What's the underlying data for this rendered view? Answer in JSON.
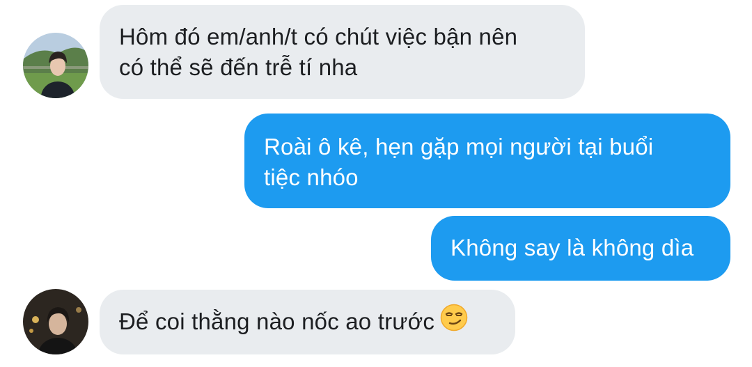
{
  "conversation": {
    "messages": [
      {
        "sender": "incoming",
        "avatar_icon": "user-avatar-outdoor-photo",
        "lines": [
          "Hôm đó em/anh/t có chút việc bận nên",
          "có thể sẽ đến trễ tí nha"
        ]
      },
      {
        "sender": "outgoing",
        "lines": [
          "Roài ô kê, hẹn gặp mọi người tại buổi",
          "tiệc nhóo"
        ]
      },
      {
        "sender": "outgoing",
        "lines": [
          "Không say là không dìa"
        ]
      },
      {
        "sender": "incoming",
        "avatar_icon": "user-avatar-night-photo",
        "lines": [
          "Để coi thằng nào nốc ao trước"
        ],
        "emoji": "smirking-face-icon"
      }
    ]
  },
  "colors": {
    "incoming_bubble": "#e9ecef",
    "outgoing_bubble": "#1d9bf0",
    "incoming_text": "#1c1e21",
    "outgoing_text": "#ffffff"
  }
}
